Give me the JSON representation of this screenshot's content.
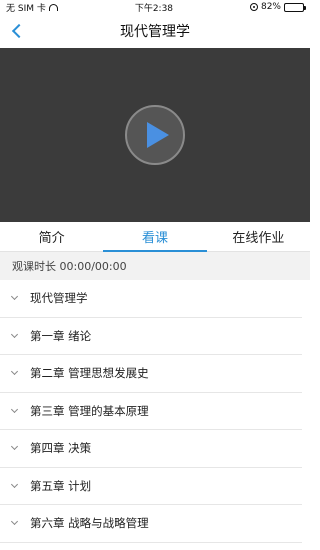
{
  "status_bar": {
    "carrier": "无 SIM 卡",
    "time": "下午2:38",
    "battery": "82%",
    "battery_level": 0.82
  },
  "nav": {
    "title": "现代管理学",
    "back_icon": "chevron-left-icon"
  },
  "video": {
    "play_icon": "play-icon"
  },
  "tabs": [
    {
      "label": "简介",
      "active": false
    },
    {
      "label": "看课",
      "active": true
    },
    {
      "label": "在线作业",
      "active": false
    }
  ],
  "watch_time": "观课时长 00:00/00:00",
  "chapters": [
    {
      "label": "现代管理学"
    },
    {
      "label": "第一章 绪论"
    },
    {
      "label": "第二章 管理思想发展史"
    },
    {
      "label": "第三章 管理的基本原理"
    },
    {
      "label": "第四章 决策"
    },
    {
      "label": "第五章 计划"
    },
    {
      "label": "第六章 战略与战略管理"
    }
  ],
  "colors": {
    "accent": "#2a8fd6",
    "play": "#4a90e2",
    "video_bg": "#3b3b3b"
  }
}
